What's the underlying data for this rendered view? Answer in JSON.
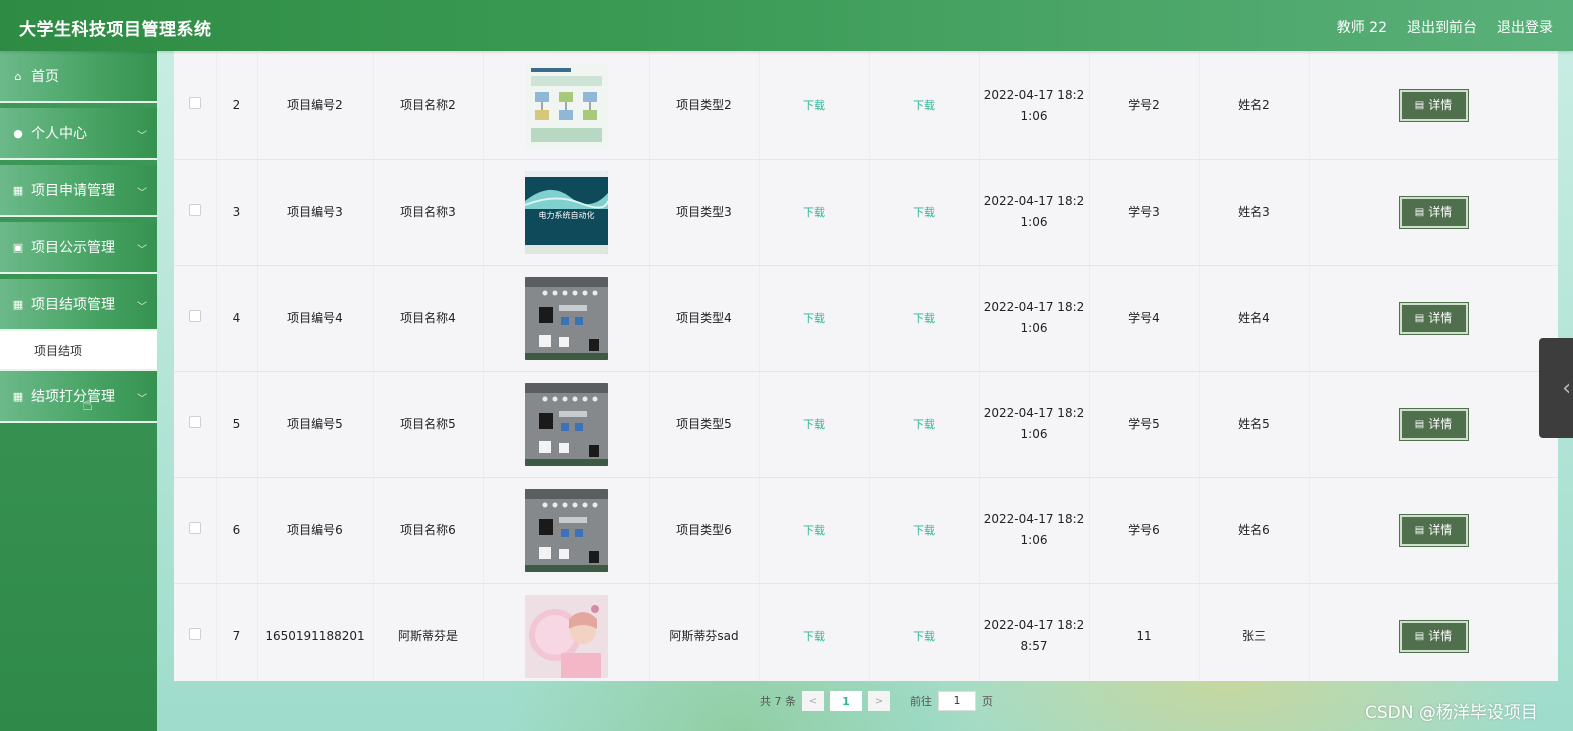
{
  "header": {
    "title": "大学生科技项目管理系统",
    "user": "教师 22",
    "to_front": "退出到前台",
    "logout": "退出登录"
  },
  "sidebar": {
    "items": [
      {
        "label": "首页",
        "icon": "home-icon",
        "glyph": "⌂",
        "has_chevron": false
      },
      {
        "label": "个人中心",
        "icon": "user-icon",
        "glyph": "●",
        "has_chevron": true
      },
      {
        "label": "项目申请管理",
        "icon": "grid-icon",
        "glyph": "▦",
        "has_chevron": true
      },
      {
        "label": "项目公示管理",
        "icon": "clipboard-icon",
        "glyph": "▣",
        "has_chevron": true
      },
      {
        "label": "项目结项管理",
        "icon": "grid-icon",
        "glyph": "▦",
        "has_chevron": true
      },
      {
        "label": "结项打分管理",
        "icon": "grid-icon",
        "glyph": "▦",
        "has_chevron": true
      }
    ],
    "submenu_label": "项目结项"
  },
  "top_cut_time": "1:06",
  "rows": [
    {
      "idx": "2",
      "code": "项目编号2",
      "name": "项目名称2",
      "type": "项目类型2",
      "dl1": "下载",
      "dl2": "下载",
      "time1": "2022-04-17 18:2",
      "time2": "1:06",
      "sid": "学号2",
      "sname": "姓名2",
      "btn": "详情",
      "thumb": "diagram",
      "color": "#e8efe9"
    },
    {
      "idx": "3",
      "code": "项目编号3",
      "name": "项目名称3",
      "type": "项目类型3",
      "dl1": "下载",
      "dl2": "下载",
      "time1": "2022-04-17 18:2",
      "time2": "1:06",
      "sid": "学号3",
      "sname": "姓名3",
      "btn": "详情",
      "thumb": "book",
      "color": "#1f5a6a"
    },
    {
      "idx": "4",
      "code": "项目编号4",
      "name": "项目名称4",
      "type": "项目类型4",
      "dl1": "下载",
      "dl2": "下载",
      "time1": "2022-04-17 18:2",
      "time2": "1:06",
      "sid": "学号4",
      "sname": "姓名4",
      "btn": "详情",
      "thumb": "panel",
      "color": "#7d7f82"
    },
    {
      "idx": "5",
      "code": "项目编号5",
      "name": "项目名称5",
      "type": "项目类型5",
      "dl1": "下载",
      "dl2": "下载",
      "time1": "2022-04-17 18:2",
      "time2": "1:06",
      "sid": "学号5",
      "sname": "姓名5",
      "btn": "详情",
      "thumb": "panel",
      "color": "#7d7f82"
    },
    {
      "idx": "6",
      "code": "项目编号6",
      "name": "项目名称6",
      "type": "项目类型6",
      "dl1": "下载",
      "dl2": "下载",
      "time1": "2022-04-17 18:2",
      "time2": "1:06",
      "sid": "学号6",
      "sname": "姓名6",
      "btn": "详情",
      "thumb": "panel",
      "color": "#7d7f82"
    },
    {
      "idx": "7",
      "code": "1650191188201",
      "name": "阿斯蒂芬是",
      "type": "阿斯蒂芬sad",
      "dl1": "下载",
      "dl2": "下载",
      "time1": "2022-04-17 18:2",
      "time2": "8:57",
      "sid": "11",
      "sname": "张三",
      "btn": "详情",
      "thumb": "photo",
      "color": "#e9c9d6"
    }
  ],
  "book_caption": "电力系统自动化",
  "pager": {
    "total": "共 7 条",
    "prev": "<",
    "current": "1",
    "next": ">",
    "goto": "前往",
    "goto_value": "1",
    "page_unit": "页"
  },
  "watermark": "CSDN @杨洋毕设项目",
  "colors": {
    "header": "#2e8b43",
    "download_link": "#2fb79a",
    "detail_button": "#4f6f4d"
  }
}
